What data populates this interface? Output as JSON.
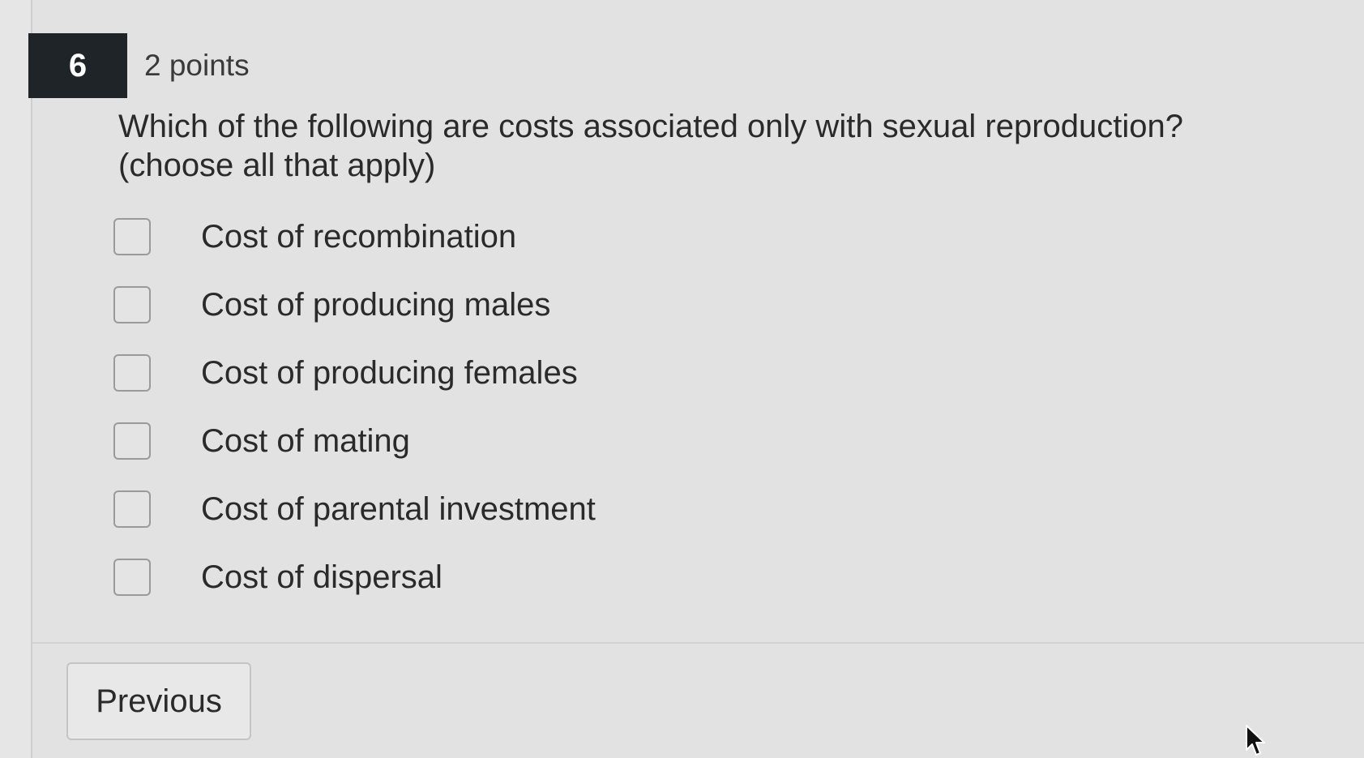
{
  "question": {
    "number": "6",
    "points": "2 points",
    "text_line1": "Which of the following are costs associated only with sexual reproduction?",
    "text_line2": "(choose all that apply)",
    "options": [
      {
        "label": "Cost of recombination",
        "checked": false
      },
      {
        "label": "Cost of producing males",
        "checked": false
      },
      {
        "label": "Cost of producing females",
        "checked": false
      },
      {
        "label": "Cost of mating",
        "checked": false
      },
      {
        "label": "Cost of parental investment",
        "checked": false
      },
      {
        "label": "Cost of dispersal",
        "checked": false
      }
    ]
  },
  "navigation": {
    "previous_label": "Previous"
  },
  "icons": {
    "pointer": "mouse-pointer-icon"
  },
  "colors": {
    "number_badge": "#1f2428",
    "background": "#e2e2e2"
  }
}
